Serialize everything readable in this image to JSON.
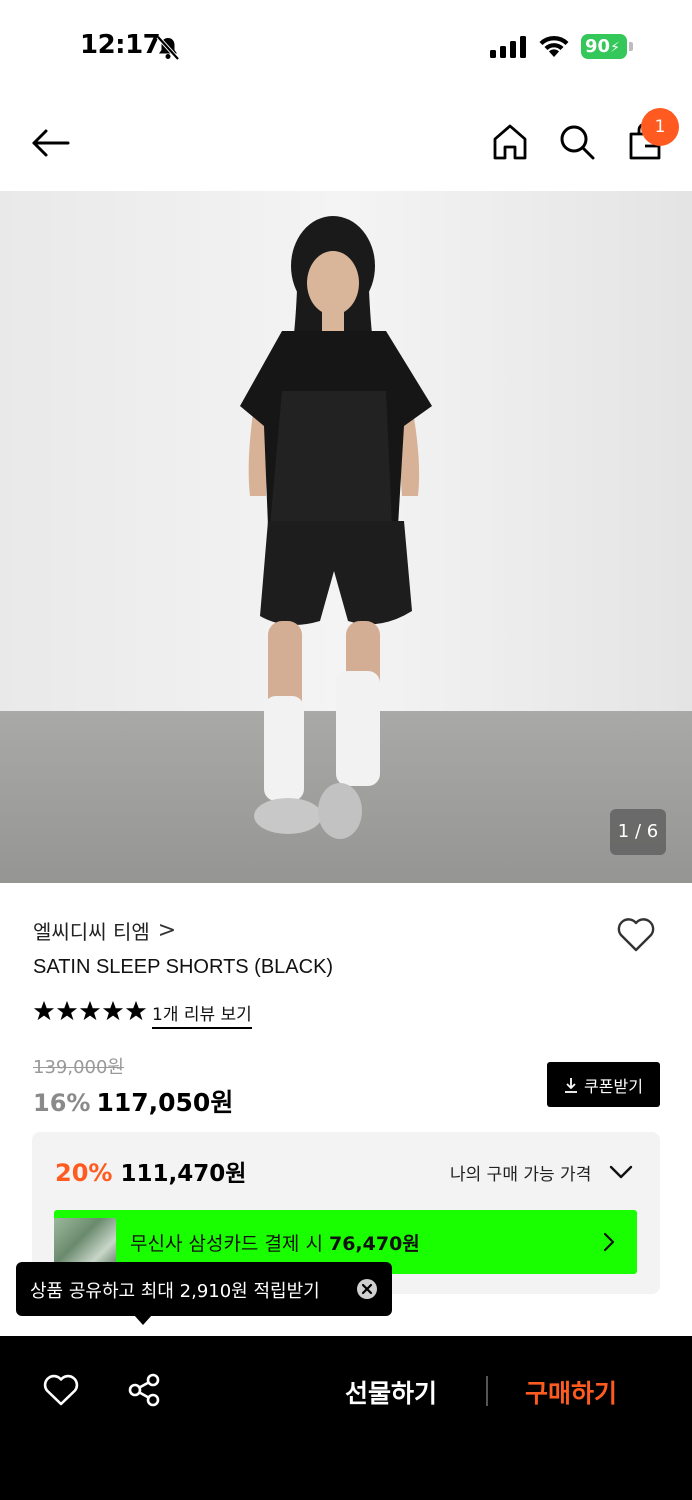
{
  "status_bar": {
    "time": "12:17",
    "battery": "90"
  },
  "header": {
    "cart_count": "1"
  },
  "gallery": {
    "counter": "1 / 6"
  },
  "product": {
    "brand": "엘씨디씨 티엠",
    "brand_chevron": ">",
    "name": "SATIN SLEEP SHORTS (BLACK)",
    "rating_stars": 5,
    "review_link": "1개 리뷰 보기",
    "original_price": "139,000원",
    "discount_rate": "16%",
    "price": "117,050원",
    "coupon_label": "쿠폰받기"
  },
  "my_price": {
    "discount_rate": "20%",
    "price": "111,470원",
    "label": "나의 구매 가능 가격",
    "card_banner_prefix": "무신사 삼성카드 결제 시 ",
    "card_banner_price": "76,470원"
  },
  "tooltip": {
    "text": "상품 공유하고 최대 2,910원 적립받기"
  },
  "bottom_bar": {
    "gift_label": "선물하기",
    "buy_label": "구매하기"
  },
  "colors": {
    "accent": "#ff5a1f",
    "card_banner": "#1aff00",
    "battery": "#34c759"
  }
}
